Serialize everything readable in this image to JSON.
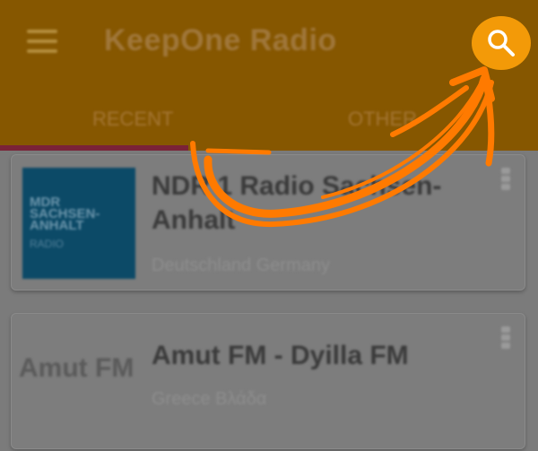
{
  "appbar": {
    "title": "KeepOne Radio",
    "tabs": [
      {
        "label": "RECENT"
      },
      {
        "label": "OTHER"
      }
    ],
    "menu_icon": "menu-icon",
    "search_icon": "search-icon",
    "search_button_color": "#f39a08",
    "background_color": "#865700",
    "indicator_color": "#7a2237"
  },
  "stations": [
    {
      "name": "NDR 1 Radio Sachsen-Anhalt",
      "subtitle": "Deutschland Germany",
      "logo_lines": [
        "MDR",
        "SACHSEN-",
        "ANHALT"
      ],
      "logo_caption": "RADIO"
    },
    {
      "name": "Amut FM - Dyilla FM",
      "subtitle": "Greece Βλάδα",
      "logo_text": "Amut FM"
    }
  ],
  "overlay": {
    "arrow_color": "#ff7a00"
  }
}
